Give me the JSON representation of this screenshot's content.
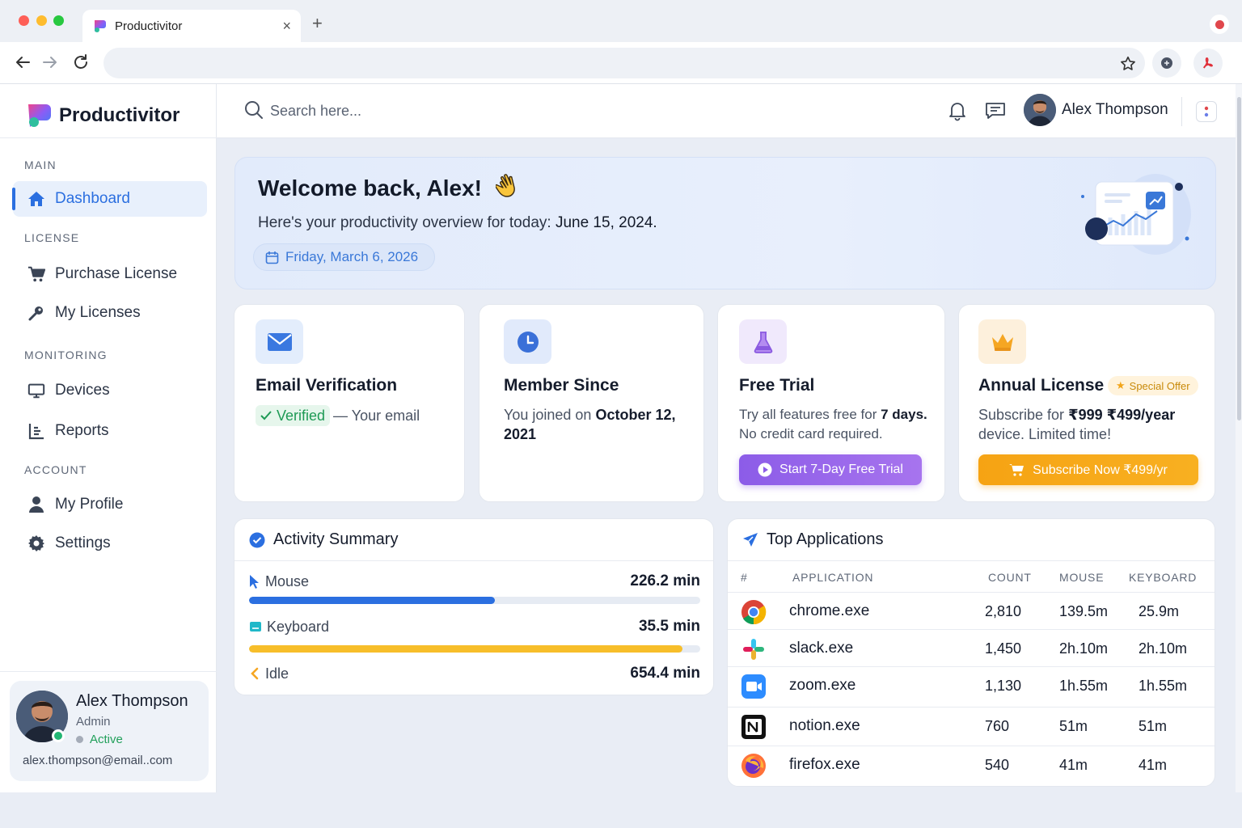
{
  "browser": {
    "tab_title": "Productivitor",
    "close_symbol": "×",
    "new_tab_symbol": "+",
    "url": ""
  },
  "app": {
    "name": "Productivitor",
    "accent_color": "#2b6fe0"
  },
  "sidebar": {
    "sections": [
      {
        "title": "MAIN",
        "items": [
          {
            "label": "Dashboard",
            "icon": "home-icon",
            "active": true
          }
        ]
      },
      {
        "title": "LICENSE",
        "items": [
          {
            "label": "Purchase License",
            "icon": "cart-icon"
          },
          {
            "label": "My Licenses",
            "icon": "key-icon"
          }
        ]
      },
      {
        "title": "MONITORING",
        "items": [
          {
            "label": "Devices",
            "icon": "monitor-icon"
          },
          {
            "label": "Reports",
            "icon": "reports-icon"
          }
        ]
      },
      {
        "title": "ACCOUNT",
        "items": [
          {
            "label": "My Profile",
            "icon": "user-icon"
          },
          {
            "label": "Settings",
            "icon": "gear-icon"
          }
        ]
      }
    ],
    "user": {
      "name": "Alex Thompson",
      "role": "Admin",
      "status": "Active",
      "email": "alex.thompson@email..com"
    }
  },
  "header": {
    "search_placeholder": "Search here...",
    "user_name": "Alex Thompson"
  },
  "welcome": {
    "title": "Welcome back, Alex!",
    "subtitle_prefix": "Here's your productivity overview for today: ",
    "subtitle_date": "June 15, 2024.",
    "date_pill": "Friday, March 6, 2026"
  },
  "cards": {
    "email": {
      "title": "Email Verification",
      "badge": "Verified",
      "text": "— Your email"
    },
    "member": {
      "title": "Member Since",
      "text_prefix": "You joined on ",
      "date": "October 12, 2021"
    },
    "trial": {
      "title": "Free Trial",
      "text_prefix": "Try all features free for ",
      "days": "7 days.",
      "text_line2": "No credit card required.",
      "button": "Start 7-Day Free Trial"
    },
    "annual": {
      "title": "Annual License",
      "badge": "Special Offer",
      "text_prefix": "Subscribe for ",
      "price": "₹999 ₹499/year",
      "text_line2": "device. Limited time!",
      "button": "Subscribe Now ₹499/yr"
    }
  },
  "activity": {
    "title": "Activity Summary",
    "rows": [
      {
        "label": "Mouse",
        "value": "226.2 min",
        "fill": 0.545,
        "color": "#2b6fe0"
      },
      {
        "label": "Keyboard",
        "value": "35.5 min",
        "fill": 0.96,
        "color": "#f7be2a"
      },
      {
        "label": "Idle",
        "value": "654.4 min"
      }
    ]
  },
  "top_apps": {
    "title": "Top Applications",
    "columns": [
      "#",
      "APPLICATION",
      "COUNT",
      "MOUSE",
      "KEYBOARD"
    ],
    "rows": [
      {
        "icon": "chrome-icon",
        "app": "chrome.exe",
        "count": "2,810",
        "mouse": "139.5m",
        "keyboard": "25.9m"
      },
      {
        "icon": "slack-icon",
        "app": "slack.exe",
        "count": "1,450",
        "mouse": "2h.10m",
        "keyboard": "2h.10m"
      },
      {
        "icon": "zoom-icon",
        "app": "zoom.exe",
        "count": "1,130",
        "mouse": "1h.55m",
        "keyboard": "1h.55m"
      },
      {
        "icon": "notion-icon",
        "app": "notion.exe",
        "count": "760",
        "mouse": "51m",
        "keyboard": "51m"
      },
      {
        "icon": "firefox-icon",
        "app": "firefox.exe",
        "count": "540",
        "mouse": "41m",
        "keyboard": "41m"
      }
    ]
  }
}
